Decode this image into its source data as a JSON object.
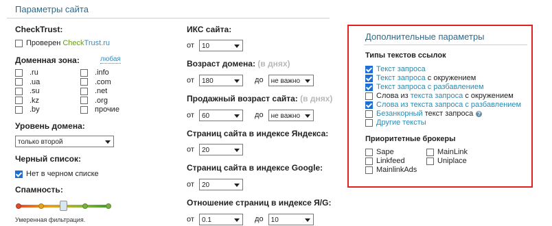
{
  "header": {
    "title": "Параметры сайта"
  },
  "checktrust": {
    "label": "CheckTrust:",
    "checkbox_prefix": "Проверен ",
    "brand_check": "Check",
    "brand_trust": "Trust",
    "brand_ru": ".ru",
    "checked": false
  },
  "domain_zone": {
    "label": "Доменная зона:",
    "any_label": "любая",
    "col1": [
      ".ru",
      ".ua",
      ".su",
      ".kz",
      ".by"
    ],
    "col2": [
      ".info",
      ".com",
      ".net",
      ".org",
      "прочие"
    ]
  },
  "domain_level": {
    "label": "Уровень домена:",
    "value": "только второй"
  },
  "blacklist": {
    "label": "Черный список:",
    "checkbox_label": "Нет в черном списке",
    "checked": true
  },
  "spam": {
    "label": "Спамность:",
    "caption": "Умеренная фильтрация.",
    "level_index": 2,
    "levels": 5
  },
  "iks": {
    "label": "ИКС сайта:",
    "from_label": "от",
    "from_value": "10"
  },
  "domain_age": {
    "label": "Возраст домена:",
    "hint": "(в днях)",
    "from_label": "от",
    "from_value": "180",
    "to_label": "до",
    "to_value": "не важно"
  },
  "sale_age": {
    "label": "Продажный возраст сайта:",
    "hint": "(в днях)",
    "from_label": "от",
    "from_value": "60",
    "to_label": "до",
    "to_value": "не важно"
  },
  "yandex_pages": {
    "label": "Страниц сайта в индексе Яндекса:",
    "from_label": "от",
    "from_value": "20"
  },
  "google_pages": {
    "label": "Страниц сайта в индексе Google:",
    "from_label": "от",
    "from_value": "20"
  },
  "ratio": {
    "label": "Отношение страниц в индексе Я/G:",
    "from_label": "от",
    "from_value": "0.1",
    "to_label": "до",
    "to_value": "10"
  },
  "extra": {
    "title": "Дополнительные параметры",
    "link_types_label": "Типы текстов ссылок",
    "link_types": [
      {
        "parts": [
          {
            "t": "Текст запроса",
            "c": "link"
          }
        ],
        "checked": true
      },
      {
        "parts": [
          {
            "t": "Текст запроса",
            "c": "link"
          },
          {
            "t": " с окружением",
            "c": "plain"
          }
        ],
        "checked": true
      },
      {
        "parts": [
          {
            "t": "Текст запроса с разбавлением",
            "c": "link"
          }
        ],
        "checked": true
      },
      {
        "parts": [
          {
            "t": "Слова из ",
            "c": "plain"
          },
          {
            "t": "текста запроса",
            "c": "link"
          },
          {
            "t": " с окружением",
            "c": "plain"
          }
        ],
        "checked": false
      },
      {
        "parts": [
          {
            "t": "Слова из текста запроса с разбавлением",
            "c": "link"
          }
        ],
        "checked": true
      },
      {
        "parts": [
          {
            "t": "Безанкорный",
            "c": "link"
          },
          {
            "t": " текст запроса",
            "c": "plain"
          }
        ],
        "checked": false,
        "help": true
      },
      {
        "parts": [
          {
            "t": "Другие тексты",
            "c": "link"
          }
        ],
        "checked": false
      }
    ],
    "brokers_label": "Приоритетные брокеры",
    "brokers_col1": [
      "Sape",
      "Linkfeed",
      "MainlinkAds"
    ],
    "brokers_col2": [
      "MainLink",
      "Uniplace"
    ]
  },
  "colors": {
    "accent": "#2e6a8a",
    "link": "#2a8ab0",
    "border_highlight": "#e02020",
    "check": "#1f6fd1"
  }
}
